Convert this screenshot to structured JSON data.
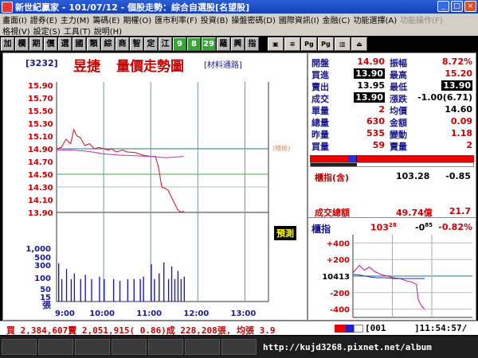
{
  "window": {
    "title": "新世紀贏家 - 101/07/12 - 個股走勢：綜合自選股[名望股]",
    "buttons": [
      "_",
      "□",
      "×"
    ]
  },
  "menu": {
    "row1": [
      "畫面(I)",
      "證券(E)",
      "主力(M)",
      "籌碼(E)",
      "期權(O)",
      "匯市利率(F)",
      "投資(B)",
      "操盤密碼(D)",
      "國際資訊(I)",
      "金融(C)",
      "功能選擇(A)",
      "功能操作(F)"
    ],
    "row1_disabled": [
      false,
      false,
      false,
      false,
      false,
      false,
      false,
      false,
      false,
      false,
      false,
      true
    ],
    "row2": [
      "格視(V)",
      "設定(S)",
      "工具(T)",
      "說明(H)"
    ]
  },
  "toolbar": {
    "buttons": [
      "加",
      "欄",
      "期",
      "價",
      "選",
      "國",
      "類",
      "綜",
      "商",
      "智",
      "定",
      "江",
      "9",
      "8",
      "29",
      "羅",
      "興",
      "指"
    ],
    "icons": [
      "chart-icon",
      "news-icon",
      "page-icon",
      "page2-icon",
      "graph-icon",
      "exit-icon"
    ],
    "icon_labels": [
      "▣",
      "≡",
      "Pg",
      "Pg",
      "▥",
      "⏏"
    ]
  },
  "header": {
    "code": "[3232]",
    "name": "昱捷",
    "title": "量價走勢圖",
    "category": "[材料通路]",
    "trademark": "(稽檢)"
  },
  "quote": {
    "open_label": "開盤",
    "open": "14.90",
    "amplitude_label": "振幅",
    "amplitude": "8.72%",
    "bid_label": "買進",
    "bid": "13.90",
    "high_label": "最高",
    "high": "15.20",
    "ask_label": "賣出",
    "ask": "13.95",
    "low_label": "最低",
    "low": "13.90",
    "deal_label": "成交",
    "deal": "13.90",
    "change_label": "漲跌",
    "change": "-1.00(6.71)",
    "vol_label": "單量",
    "vol": "2",
    "avg_label": "均價",
    "avg": "14.60",
    "total_label": "總量",
    "total": "630",
    "amount_label": "金額",
    "amount": "0.09",
    "yest_label": "昨量",
    "yest": "535",
    "var_label": "變動",
    "var": "1.18",
    "buyvol_label": "買量",
    "buyvol": "59",
    "sellvol_label": "賣量",
    "sellvol": "2"
  },
  "index": {
    "label": "櫃指(含)",
    "value": "103.28",
    "change": "-0.85",
    "turnover_label": "成交總額",
    "turnover": "49.74億",
    "turnover_change": "21.7",
    "mini_label": "櫃指",
    "mini_value": "103",
    "mini_value_frac": "28",
    "mini_change": "-0",
    "mini_change_frac": "85",
    "mini_pct": "-0.82%"
  },
  "ticker_label": "預測",
  "status": {
    "text": "買 2,384,607賣 2,051,915( 0.86)成 228,208張, 均張 3.9",
    "order": "[001",
    "clock": "]11:54:57/"
  },
  "taskbar": {
    "items": [
      "",
      "",
      "",
      "",
      "",
      "",
      ""
    ],
    "url": "http://kujd3268.pixnet.net/album"
  },
  "chart_data": [
    {
      "type": "line",
      "title": "量價走勢圖",
      "y_price_ticks": [
        "15.90",
        "15.70",
        "15.50",
        "15.30",
        "15.10",
        "14.90",
        "14.70",
        "14.50",
        "14.30",
        "14.10",
        "13.90"
      ],
      "y_volume_ticks": [
        "1,000",
        "500",
        "300",
        "100",
        "50",
        "15"
      ],
      "y_volume_unit": "張",
      "x_ticks": [
        "9:00",
        "10:00",
        "11:00",
        "12:00",
        "13:00"
      ],
      "ylim": [
        13.9,
        15.9
      ],
      "reference_price": 14.9,
      "series": [
        {
          "type": "line",
          "color": "#d01020",
          "x_minutes": [
            0,
            6,
            12,
            18,
            22,
            26,
            30,
            36,
            42,
            48,
            54,
            60,
            66,
            70,
            76,
            84,
            90,
            100,
            110,
            120,
            126,
            130,
            134,
            138,
            142,
            146,
            150,
            154,
            158,
            162
          ],
          "y": [
            14.9,
            14.92,
            15.05,
            14.98,
            15.2,
            15.1,
            15.08,
            14.95,
            14.98,
            14.9,
            14.92,
            14.9,
            14.88,
            14.9,
            14.85,
            14.88,
            14.85,
            14.84,
            14.8,
            14.78,
            14.78,
            14.6,
            14.3,
            14.28,
            14.25,
            14.15,
            14.05,
            13.95,
            13.9,
            13.92
          ]
        },
        {
          "type": "line",
          "color": "#c030c0",
          "x_minutes": [
            0,
            20,
            40,
            60,
            80,
            100,
            120,
            140,
            162
          ],
          "y": [
            14.88,
            14.88,
            14.86,
            14.82,
            14.8,
            14.79,
            14.78,
            14.76,
            14.78
          ]
        }
      ],
      "volume_bars": [
        {
          "x_minutes": 2,
          "v": 100
        },
        {
          "x_minutes": 6,
          "v": 15
        },
        {
          "x_minutes": 12,
          "v": 50
        },
        {
          "x_minutes": 18,
          "v": 15
        },
        {
          "x_minutes": 22,
          "v": 30
        },
        {
          "x_minutes": 30,
          "v": 15
        },
        {
          "x_minutes": 36,
          "v": 25
        },
        {
          "x_minutes": 44,
          "v": 15
        },
        {
          "x_minutes": 54,
          "v": 20
        },
        {
          "x_minutes": 60,
          "v": 15
        },
        {
          "x_minutes": 72,
          "v": 15
        },
        {
          "x_minutes": 80,
          "v": 12
        },
        {
          "x_minutes": 90,
          "v": 15
        },
        {
          "x_minutes": 98,
          "v": 15
        },
        {
          "x_minutes": 106,
          "v": 15
        },
        {
          "x_minutes": 110,
          "v": 20
        },
        {
          "x_minutes": 120,
          "v": 90
        },
        {
          "x_minutes": 124,
          "v": 15
        },
        {
          "x_minutes": 130,
          "v": 30
        },
        {
          "x_minutes": 136,
          "v": 110
        },
        {
          "x_minutes": 142,
          "v": 15
        },
        {
          "x_minutes": 146,
          "v": 70
        },
        {
          "x_minutes": 150,
          "v": 15
        },
        {
          "x_minutes": 154,
          "v": 40
        },
        {
          "x_minutes": 158,
          "v": 15
        },
        {
          "x_minutes": 162,
          "v": 20
        }
      ]
    },
    {
      "type": "line",
      "y_ticks": [
        "+400",
        "+200",
        "10413",
        "-200",
        "-400"
      ],
      "ylim": [
        -500,
        500
      ],
      "series": [
        {
          "type": "line",
          "color": "#d01090",
          "x": [
            0,
            8,
            14,
            20,
            26,
            34,
            42,
            50,
            58,
            66,
            72,
            78,
            80,
            84,
            88
          ],
          "y": [
            40,
            130,
            70,
            110,
            60,
            20,
            0,
            -20,
            -30,
            -60,
            -70,
            -100,
            -280,
            -360,
            -400
          ]
        },
        {
          "type": "line",
          "color": "#2030c0",
          "x": [
            0,
            10,
            20,
            30,
            40,
            50,
            60,
            70,
            80,
            88
          ],
          "y": [
            20,
            10,
            -10,
            -20,
            -20,
            -30,
            -30,
            -30,
            -30,
            -30
          ]
        }
      ]
    }
  ]
}
